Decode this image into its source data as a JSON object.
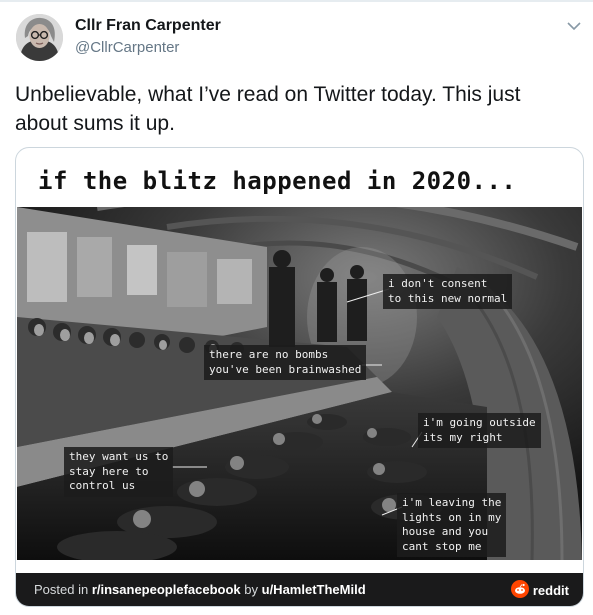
{
  "author": {
    "name": "Cllr Fran Carpenter",
    "handle": "@CllrCarpenter"
  },
  "tweet": {
    "text": "Unbelievable, what I’ve read on Twitter today. This just about sums it up."
  },
  "meme": {
    "title": "if the blitz happened in 2020...",
    "captions": [
      "i don't consent\nto this new normal",
      "there are no bombs\nyou've been brainwashed",
      "i'm going outside\nits my right",
      "they want us to\nstay here to\ncontrol us",
      "i'm leaving the\nlights on in my\nhouse and you\ncant stop me"
    ]
  },
  "footer": {
    "prefix": "Posted in ",
    "subreddit": "r/insanepeoplefacebook",
    "by": " by ",
    "user": "u/HamletTheMild",
    "brand": "reddit"
  },
  "colors": {
    "text_primary": "#14171a",
    "text_secondary": "#657786",
    "reddit_orange": "#ff4500",
    "footer_bg": "#1a1a1b"
  }
}
